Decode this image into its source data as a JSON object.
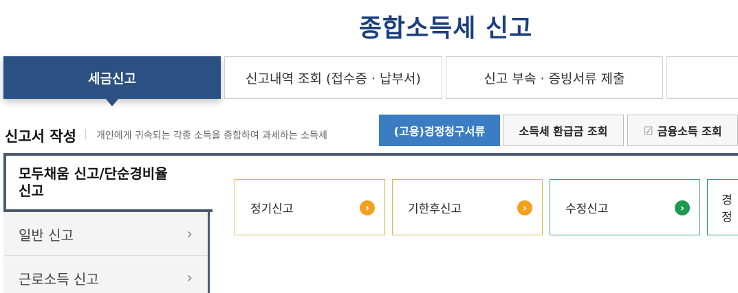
{
  "page_title": "종합소득세  신고",
  "tabs": [
    {
      "label": "세금신고",
      "active": true
    },
    {
      "label": "신고내역 조회 (접수증 · 납부서)",
      "active": false
    },
    {
      "label": "신고 부속 · 증빙서류 제출",
      "active": false
    },
    {
      "label": "·",
      "active": false
    }
  ],
  "section": {
    "title": "신고서 작성",
    "description": "개인에게 귀속되는 각종 소득을 종합하여 과세하는 소득세"
  },
  "quick_buttons": {
    "employment_claim": "(고용)경정청구서류",
    "refund_lookup": "소득세 환급금 조회",
    "financial_income": "금융소득 조회",
    "financial_icon": "checkbox-icon"
  },
  "sidebar": {
    "items": [
      {
        "label": "모두채움 신고/단순경비율 신고",
        "active": true
      },
      {
        "label": "일반 신고",
        "active": false
      },
      {
        "label": "근로소득 신고",
        "active": false
      }
    ]
  },
  "cards": [
    {
      "label": "정기신고",
      "accent": "#f2a020"
    },
    {
      "label": "기한후신고",
      "accent": "#f2a020"
    },
    {
      "label": "수정신고",
      "accent": "#1d9a4d"
    },
    {
      "label": "경정",
      "accent": "#1d9a4d"
    }
  ],
  "colors": {
    "brand_navy": "#1b3f7e",
    "active_tab": "#2b5083",
    "primary_button": "#3a7dc3",
    "panel_border": "#4d5a6e"
  }
}
